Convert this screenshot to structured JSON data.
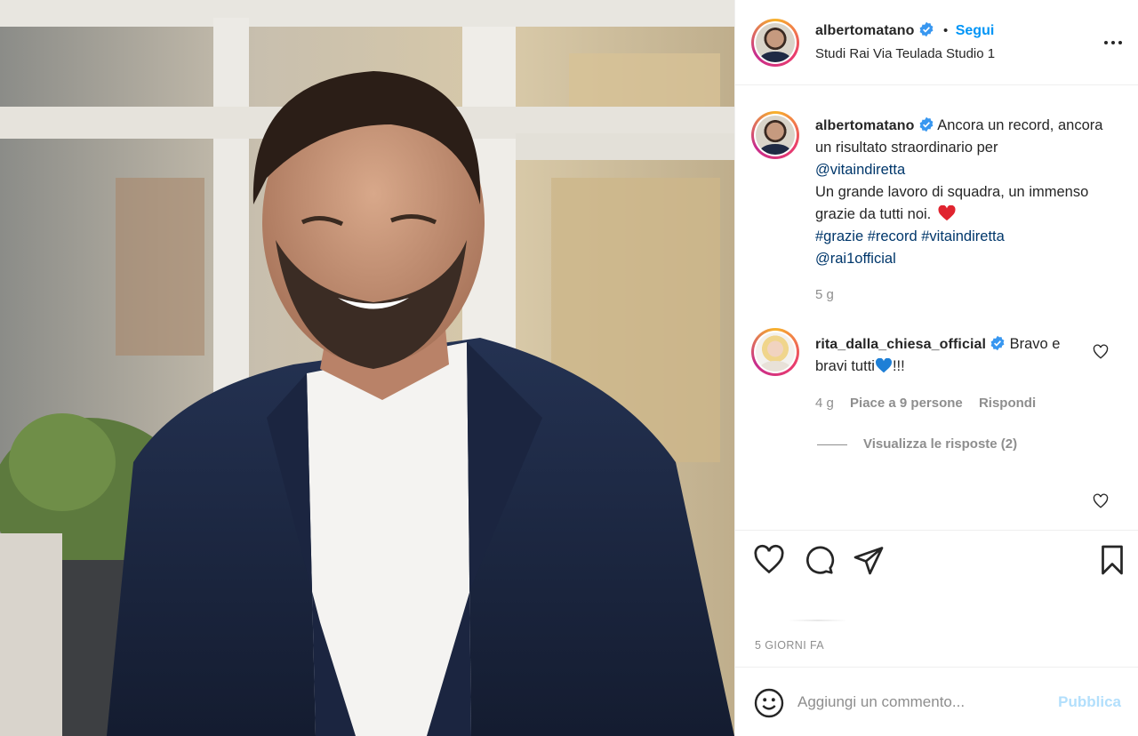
{
  "post": {
    "photo_alt": "",
    "header": {
      "username": "albertomatano",
      "separator": "•",
      "follow_label": "Segui",
      "location": "Studi Rai Via Teulada Studio 1"
    },
    "caption": {
      "username": "albertomatano",
      "line1": "Ancora un record, ancora un risultato straordinario per",
      "mention1": "@vitaindiretta",
      "line2": "Un grande lavoro di squadra, un immenso grazie da tutti noi.",
      "hashtags": "#grazie #record #vitaindiretta",
      "mention2": "@rai1official",
      "age": "5 g"
    },
    "comment": {
      "username": "rita_dalla_chiesa_official",
      "text_before": "Bravo e bravi tutti",
      "text_after": "!!!",
      "age": "4 g",
      "likes": "Piace a 9 persone",
      "reply_label": "Rispondi",
      "view_replies": "Visualizza le risposte (2)"
    },
    "date": "5 GIORNI FA",
    "add_comment": {
      "placeholder": "Aggiungi un commento...",
      "publish_label": "Pubblica"
    }
  },
  "colors": {
    "accent": "#0095f6",
    "publish_disabled": "#b2dffc",
    "muted": "#8e8e8e",
    "verified": "#3897f0"
  },
  "icons": [
    "verified-icon",
    "more-options-icon",
    "heart-icon",
    "comment-icon",
    "share-icon",
    "bookmark-icon",
    "emoji-icon",
    "red-heart-emoji",
    "blue-heart-emoji"
  ]
}
